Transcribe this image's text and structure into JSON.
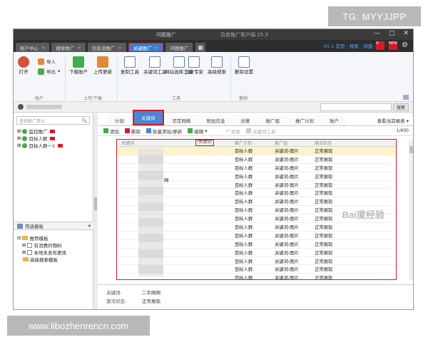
{
  "watermarks": {
    "top_right": "TG: MYYJJPP",
    "bottom_left": "www.libozhenrencn.com",
    "baidu": "Bai度经验"
  },
  "window": {
    "title": "问题推广",
    "subtitle": "百度推广客户端 15.3",
    "controls": [
      "—",
      "□",
      "✕"
    ]
  },
  "tabs": [
    {
      "label": "账户中心",
      "active": false
    },
    {
      "label": "搜索推广",
      "active": false
    },
    {
      "label": "信息流推广",
      "active": false
    },
    {
      "label": "关键推广",
      "active": true
    },
    {
      "label": "问题推广",
      "active": false
    }
  ],
  "tab_right_text": "V5.1 首页 - 搜索 - 网盟 - ...",
  "ribbon": {
    "account": {
      "open": "打开",
      "import": "导入",
      "export": "导出",
      "group": "账户"
    },
    "updown": {
      "download": "下载账户",
      "upload": "上传更新",
      "group": "上传/下载"
    },
    "tools": {
      "copy": "复制工具",
      "kw_tool": "关键词工具",
      "kw_tool2": "工具",
      "netcall": "网站选择工具",
      "netcall2": "择工具",
      "expert": "创意专家",
      "advanced": "高级搜索",
      "group": "工具"
    },
    "fallback": {
      "settings": "删除设置",
      "group": "撤销"
    }
  },
  "search_button": "搜索",
  "left_panel": {
    "search_placeholder": "查找推广单元",
    "tree": [
      {
        "label": "监控推广",
        "badge": true
      },
      {
        "label": "目标人群",
        "badge": true
      },
      {
        "label": "目标人群一1",
        "badge": true
      }
    ],
    "filter_title": "筛选模板",
    "filter_tree": [
      "推荐模板",
      "有消费的物料",
      "本地未发布更改",
      "高级搜索模板"
    ]
  },
  "main_tabs": [
    {
      "label": "计划",
      "active": false
    },
    {
      "label": "关键词",
      "active": true
    },
    {
      "label": "否定网络",
      "active": false
    },
    {
      "label": "附加信息",
      "active": false
    },
    {
      "label": "创意",
      "active": false
    },
    {
      "label": "推广组",
      "active": false
    },
    {
      "label": "推广计划",
      "active": false
    },
    {
      "label": "账户",
      "active": false
    }
  ],
  "main_tab_right": "查看当前报表 ▾",
  "toolbar2": {
    "add": "添加",
    "delete": "删除",
    "batch": "批量添加/更新",
    "edit": "编辑",
    "replace": "恢复",
    "kw_tool": "关键词工具",
    "page": "1/600"
  },
  "grid": {
    "headers": [
      "关键词",
      "关键词",
      "推广计划",
      "推广组",
      "激活状态"
    ],
    "visible_keyword": "网",
    "rows": [
      [
        "目标人群",
        "关键词-图片",
        "正常展现"
      ],
      [
        "目标人群",
        "关键词-图片",
        "正常展现"
      ],
      [
        "目标人群",
        "关键词-图片",
        "正常展现"
      ],
      [
        "目标人群",
        "关键词-图片",
        "正常展现"
      ],
      [
        "目标人群",
        "关键词-图片",
        "正常展现"
      ],
      [
        "目标人群",
        "关键词-图片",
        "正常展现"
      ],
      [
        "目标人群",
        "关键词-图片",
        "正常展现"
      ],
      [
        "目标人群",
        "关键词-图片",
        "正常展现"
      ],
      [
        "目标人群",
        "关键词-图片",
        "正常展现"
      ],
      [
        "目标人群",
        "关键词-图片",
        "正常展现"
      ],
      [
        "目标人群",
        "关键词-图片",
        "正常展现"
      ],
      [
        "目标人群",
        "关键词-图片",
        "正常展现"
      ],
      [
        "目标人群",
        "关键词-图片",
        "正常展现"
      ],
      [
        "目标人群",
        "关键词-图片",
        "正常展现"
      ],
      [
        "目标人群",
        "关键词-图片",
        "正常展现"
      ],
      [
        "目标人群",
        "关键词-图片",
        "正常展现"
      ]
    ]
  },
  "detail": {
    "kw_label": "关键词:",
    "kw_value": "二手网网",
    "status_label": "激活状态:",
    "status_value": "正常展现"
  },
  "colors": {
    "accent_blue": "#4a86d1",
    "highlight_red": "#d8192b",
    "titlebar": "#3b3b3b"
  }
}
